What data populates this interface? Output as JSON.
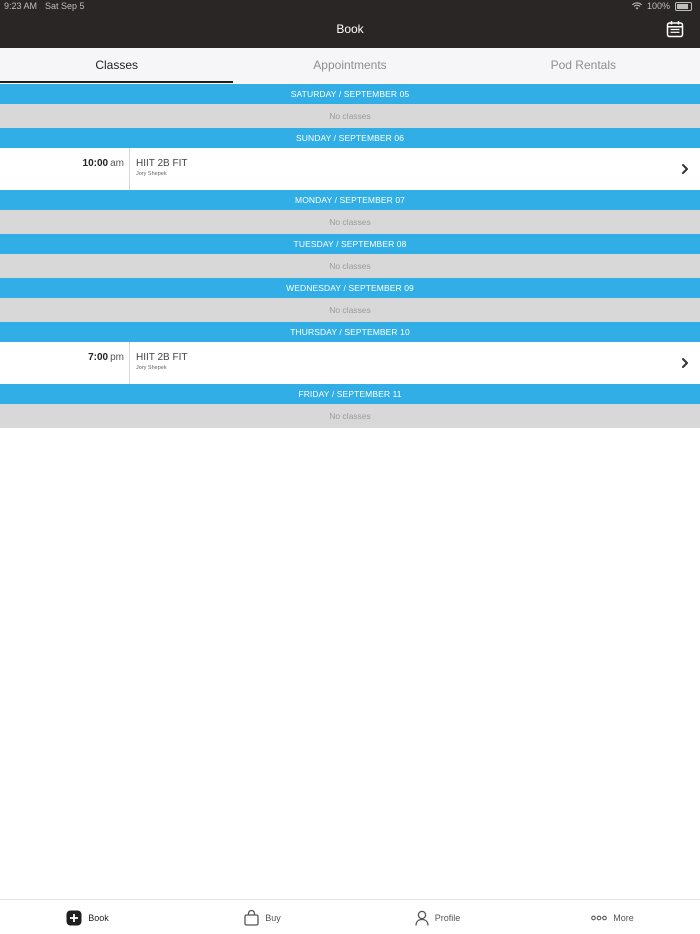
{
  "status_bar": {
    "time": "9:23 AM",
    "date": "Sat Sep 5",
    "battery": "100%"
  },
  "header": {
    "title": "Book"
  },
  "tabs": [
    {
      "label": "Classes",
      "active": true
    },
    {
      "label": "Appointments",
      "active": false
    },
    {
      "label": "Pod Rentals",
      "active": false
    }
  ],
  "schedule": {
    "no_classes_text": "No classes",
    "days": [
      {
        "header": "SATURDAY / SEPTEMBER 05"
      },
      {
        "header": "SUNDAY / SEPTEMBER 06",
        "class": {
          "time": "10:00",
          "ampm": "am",
          "name": "HIIT 2B FIT",
          "instructor": "Jory Shepek"
        }
      },
      {
        "header": "MONDAY / SEPTEMBER 07"
      },
      {
        "header": "TUESDAY / SEPTEMBER 08"
      },
      {
        "header": "WEDNESDAY / SEPTEMBER 09"
      },
      {
        "header": "THURSDAY / SEPTEMBER 10",
        "class": {
          "time": "7:00",
          "ampm": "pm",
          "name": "HIIT 2B FIT",
          "instructor": "Jory Shepek"
        }
      },
      {
        "header": "FRIDAY / SEPTEMBER 11"
      }
    ]
  },
  "bottom_nav": [
    {
      "label": "Book",
      "icon": "plus-square-icon"
    },
    {
      "label": "Buy",
      "icon": "shopping-bag-icon"
    },
    {
      "label": "Profile",
      "icon": "person-icon"
    },
    {
      "label": "More",
      "icon": "more-dots-icon"
    }
  ],
  "colors": {
    "header_bg": "#2a2626",
    "day_header_bg": "#31aee6",
    "no_classes_bg": "#d8d8d8"
  }
}
